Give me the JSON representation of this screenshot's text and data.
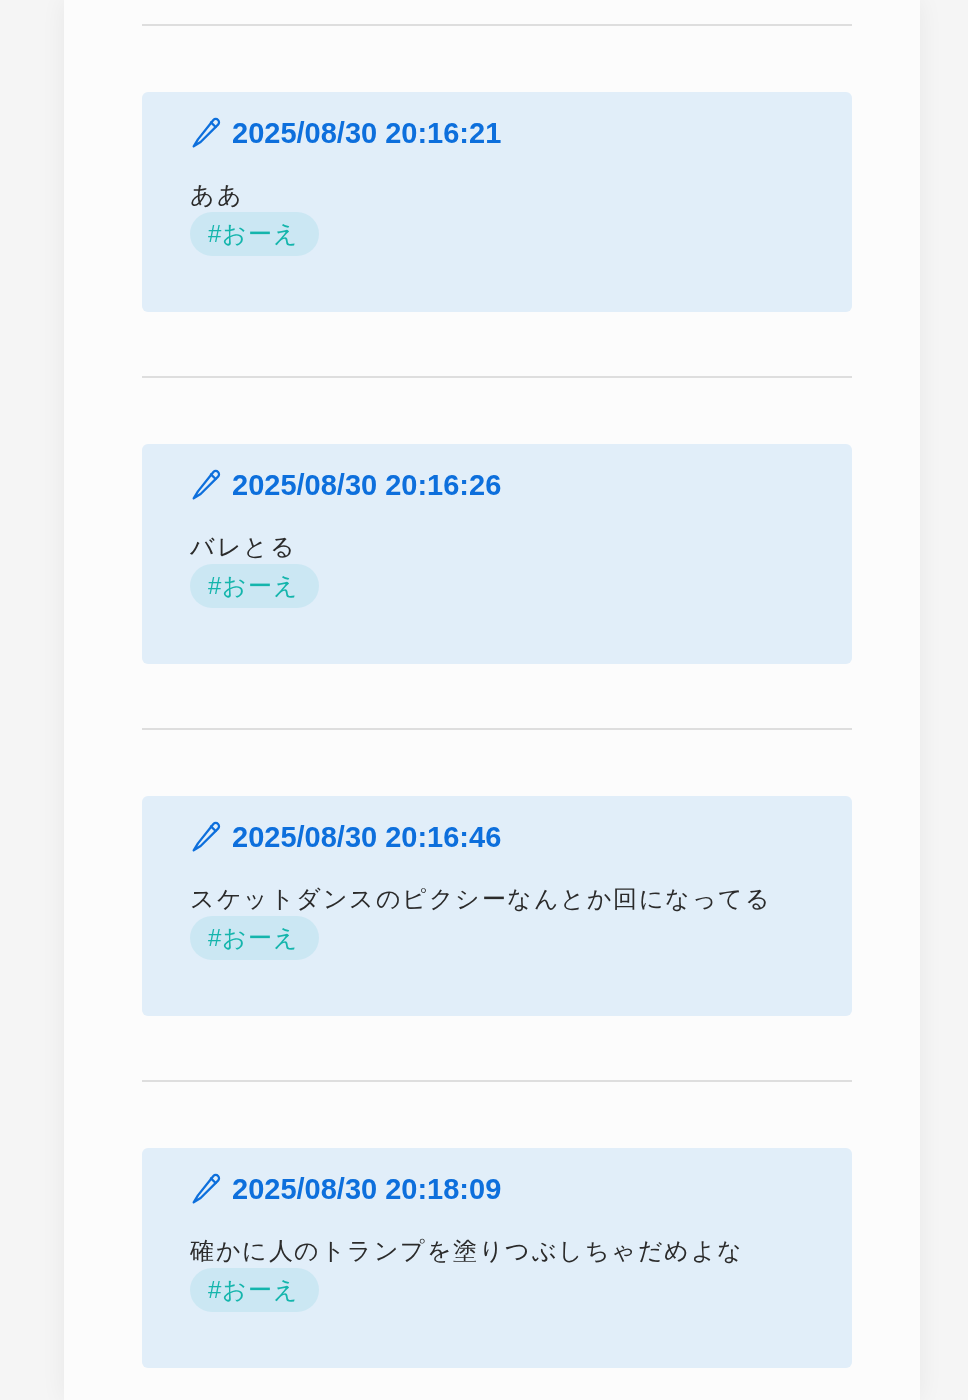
{
  "posts": [
    {
      "timestamp": "2025/08/30 20:16:21",
      "text": "ああ",
      "tags": [
        "#おーえ"
      ]
    },
    {
      "timestamp": "2025/08/30 20:16:26",
      "text": "バレとる",
      "tags": [
        "#おーえ"
      ]
    },
    {
      "timestamp": "2025/08/30 20:16:46",
      "text": "スケットダンスのピクシーなんとか回になってる",
      "tags": [
        "#おーえ"
      ]
    },
    {
      "timestamp": "2025/08/30 20:18:09",
      "text": "確かに人のトランプを塗りつぶしちゃだめよな",
      "tags": [
        "#おーえ"
      ]
    }
  ]
}
